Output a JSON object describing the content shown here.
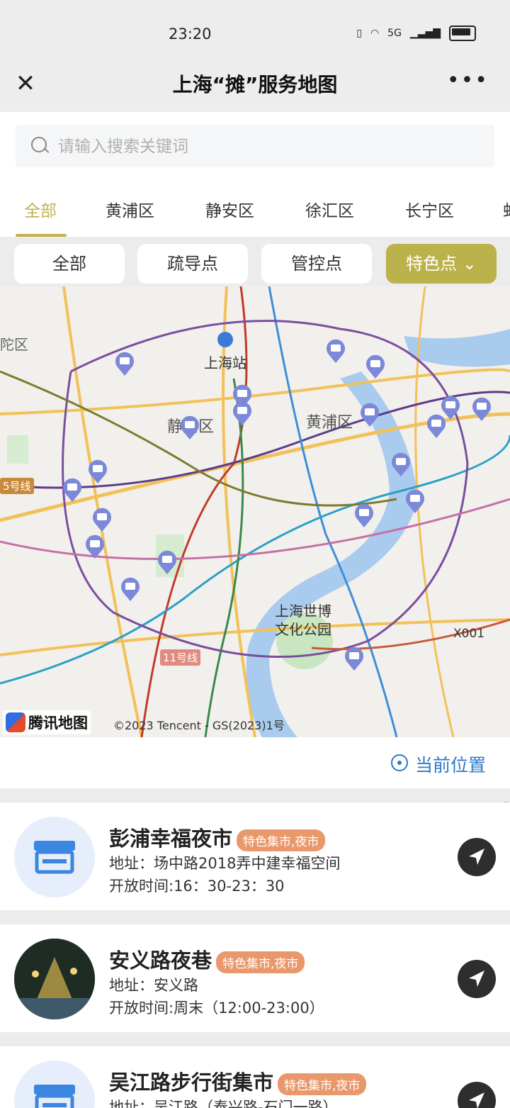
{
  "status_bar": {
    "time": "23:20",
    "signal_label": "5G"
  },
  "title_bar": {
    "title": "上海“摊”服务地图"
  },
  "search": {
    "placeholder": "请输入搜索关键词"
  },
  "district_tabs": [
    {
      "label": "全部",
      "active": true
    },
    {
      "label": "黄浦区",
      "active": false
    },
    {
      "label": "静安区",
      "active": false
    },
    {
      "label": "徐汇区",
      "active": false
    },
    {
      "label": "长宁区",
      "active": false
    },
    {
      "label": "虹",
      "active": false
    }
  ],
  "filters": [
    {
      "label": "全部",
      "active": false
    },
    {
      "label": "疏导点",
      "active": false
    },
    {
      "label": "管控点",
      "active": false
    },
    {
      "label": "特色点",
      "active": true
    }
  ],
  "map": {
    "labels": [
      "上海站",
      "静安区",
      "黄浦区",
      "上海世博",
      "文化公园",
      "X001",
      "11号线",
      "5号线",
      "陀区"
    ],
    "brand": "腾讯地图",
    "copyright": "©2023 Tencent - GS(2023)1号"
  },
  "location_button": {
    "label": "当前位置"
  },
  "markets": [
    {
      "name": "彭浦幸福夜市",
      "tag": "特色集市,夜市",
      "address": "地址：场中路2018弄中建幸福空间",
      "hours": "开放时间:16：30-23：30"
    },
    {
      "name": "安义路夜巷",
      "tag": "特色集市,夜市",
      "address": "地址：安义路",
      "hours": "开放时间:周末（12:00-23:00）"
    },
    {
      "name": "吴江路步行街集市",
      "tag": "特色集市,夜市",
      "address": "地址：吴江路（泰兴路-石门一路）",
      "hours": ""
    }
  ],
  "colors": {
    "accent": "#bcb24c",
    "tag": "#e9986c",
    "link": "#2b79c9"
  }
}
